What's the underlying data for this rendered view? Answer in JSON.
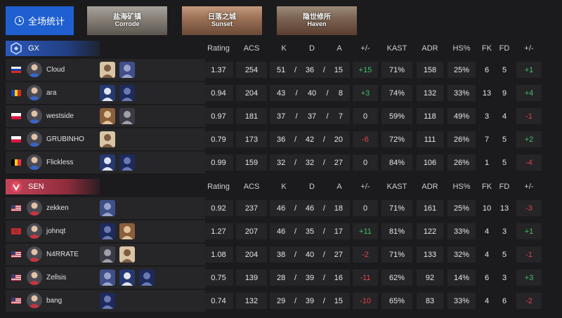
{
  "tabs": {
    "overall_label": "全场统计",
    "maps": [
      {
        "cn": "盐海矿镇",
        "en": "Corrode"
      },
      {
        "cn": "日落之城",
        "en": "Sunset"
      },
      {
        "cn": "隐世修所",
        "en": "Haven"
      }
    ]
  },
  "columns": [
    "Rating",
    "ACS",
    "K",
    "D",
    "A",
    "+/-",
    "KAST",
    "ADR",
    "HS%",
    "FK",
    "FD",
    "+/-"
  ],
  "colors": {
    "positive": "#3fbf6a",
    "negative": "#e0404a",
    "accent": "#1f5fd0"
  },
  "teams": [
    {
      "name": "GX",
      "players": [
        {
          "name": "Cloud",
          "flag": "russia",
          "agents": 2,
          "rating": "1.37",
          "acs": "254",
          "k": "51",
          "d": "36",
          "a": "15",
          "pm": "+15",
          "kast": "71%",
          "adr": "158",
          "hs": "25%",
          "fk": "6",
          "fd": "5",
          "fkpm": "+1"
        },
        {
          "name": "ara",
          "flag": "romania",
          "agents": 2,
          "rating": "0.94",
          "acs": "204",
          "k": "43",
          "d": "40",
          "a": "8",
          "pm": "+3",
          "kast": "74%",
          "adr": "132",
          "hs": "33%",
          "fk": "13",
          "fd": "9",
          "fkpm": "+4"
        },
        {
          "name": "westside",
          "flag": "poland",
          "agents": 2,
          "rating": "0.97",
          "acs": "181",
          "k": "37",
          "d": "37",
          "a": "7",
          "pm": "0",
          "kast": "59%",
          "adr": "118",
          "hs": "49%",
          "fk": "3",
          "fd": "4",
          "fkpm": "-1"
        },
        {
          "name": "GRUBINHO",
          "flag": "poland",
          "agents": 1,
          "rating": "0.79",
          "acs": "173",
          "k": "36",
          "d": "42",
          "a": "20",
          "pm": "-6",
          "kast": "72%",
          "adr": "111",
          "hs": "26%",
          "fk": "7",
          "fd": "5",
          "fkpm": "+2"
        },
        {
          "name": "Flickless",
          "flag": "belgium",
          "agents": 2,
          "rating": "0.99",
          "acs": "159",
          "k": "32",
          "d": "32",
          "a": "27",
          "pm": "0",
          "kast": "84%",
          "adr": "106",
          "hs": "26%",
          "fk": "1",
          "fd": "5",
          "fkpm": "-4"
        }
      ]
    },
    {
      "name": "SEN",
      "players": [
        {
          "name": "zekken",
          "flag": "usa",
          "agents": 1,
          "rating": "0.92",
          "acs": "237",
          "k": "46",
          "d": "46",
          "a": "18",
          "pm": "0",
          "kast": "71%",
          "adr": "161",
          "hs": "25%",
          "fk": "10",
          "fd": "13",
          "fkpm": "-3"
        },
        {
          "name": "johnqt",
          "flag": "morocco",
          "agents": 2,
          "rating": "1.27",
          "acs": "207",
          "k": "46",
          "d": "35",
          "a": "17",
          "pm": "+11",
          "kast": "81%",
          "adr": "122",
          "hs": "33%",
          "fk": "4",
          "fd": "3",
          "fkpm": "+1"
        },
        {
          "name": "N4RRATE",
          "flag": "usa",
          "agents": 2,
          "rating": "1.08",
          "acs": "204",
          "k": "38",
          "d": "40",
          "a": "27",
          "pm": "-2",
          "kast": "71%",
          "adr": "133",
          "hs": "32%",
          "fk": "4",
          "fd": "5",
          "fkpm": "-1"
        },
        {
          "name": "Zellsis",
          "flag": "usa",
          "agents": 3,
          "rating": "0.75",
          "acs": "139",
          "k": "28",
          "d": "39",
          "a": "16",
          "pm": "-11",
          "kast": "62%",
          "adr": "92",
          "hs": "14%",
          "fk": "6",
          "fd": "3",
          "fkpm": "+3"
        },
        {
          "name": "bang",
          "flag": "usa",
          "agents": 1,
          "rating": "0.74",
          "acs": "132",
          "k": "29",
          "d": "39",
          "a": "15",
          "pm": "-10",
          "kast": "65%",
          "adr": "83",
          "hs": "33%",
          "fk": "4",
          "fd": "6",
          "fkpm": "-2"
        }
      ]
    }
  ]
}
